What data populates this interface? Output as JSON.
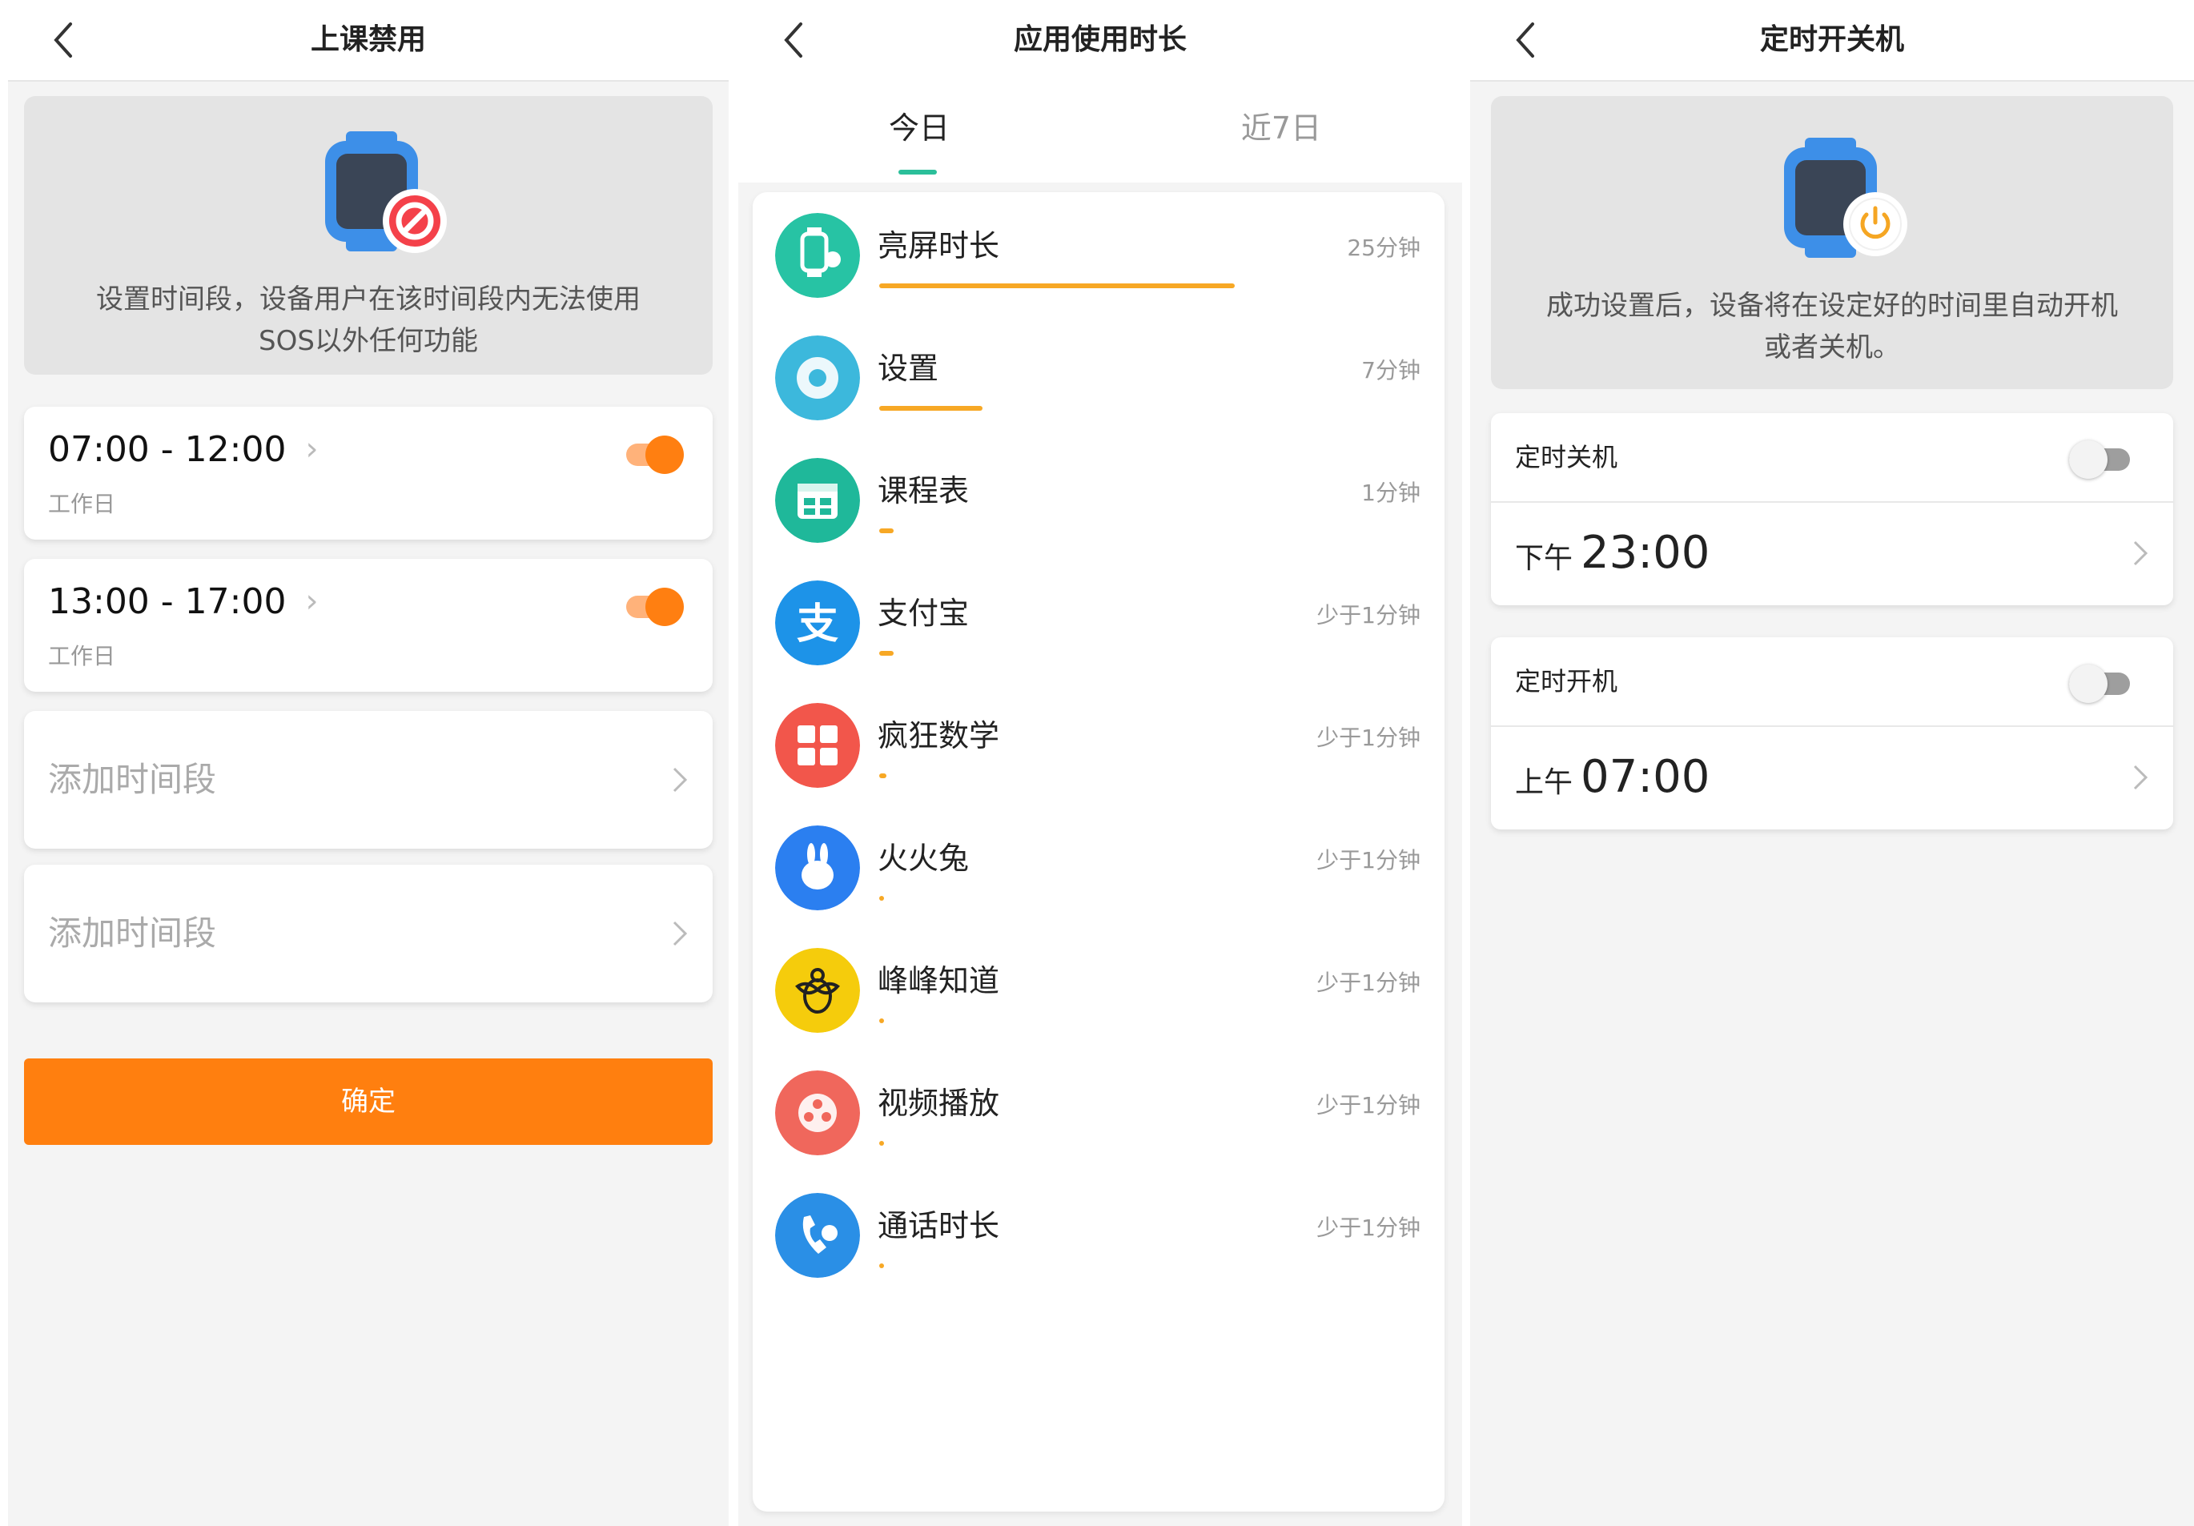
{
  "panel1": {
    "title": "上课禁用",
    "hero_text": "设置时间段，设备用户在该时间段内无法使用SOS以外任何功能",
    "periods": [
      {
        "time": "07:00 - 12:00",
        "days": "工作日",
        "enabled": true
      },
      {
        "time": "13:00 - 17:00",
        "days": "工作日",
        "enabled": true
      }
    ],
    "add_period_labels": [
      "添加时间段",
      "添加时间段"
    ],
    "confirm_label": "确定"
  },
  "panel2": {
    "title": "应用使用时长",
    "tabs": [
      {
        "label": "今日",
        "active": true
      },
      {
        "label": "近7日",
        "active": false
      }
    ],
    "apps": [
      {
        "name": "亮屏时长",
        "duration": "25分钟",
        "usage_fraction": 0.48,
        "icon": "watch-screen-icon",
        "color": "#27c3a4"
      },
      {
        "name": "设置",
        "duration": "7分钟",
        "usage_fraction": 0.14,
        "icon": "gear-icon",
        "color": "#3cb8dc"
      },
      {
        "name": "课程表",
        "duration": "1分钟",
        "usage_fraction": 0.02,
        "icon": "calendar-icon",
        "color": "#1fb89a"
      },
      {
        "name": "支付宝",
        "duration": "少于1分钟",
        "usage_fraction": 0.02,
        "icon": "alipay-icon",
        "color": "#1d93e8"
      },
      {
        "name": "疯狂数学",
        "duration": "少于1分钟",
        "usage_fraction": 0.01,
        "icon": "calculator-icon",
        "color": "#f2564b"
      },
      {
        "name": "火火兔",
        "duration": "少于1分钟",
        "usage_fraction": 0.005,
        "icon": "rabbit-icon",
        "color": "#2b7ff0"
      },
      {
        "name": "峰峰知道",
        "duration": "少于1分钟",
        "usage_fraction": 0.005,
        "icon": "bee-icon",
        "color": "#f5cc0c"
      },
      {
        "name": "视频播放",
        "duration": "少于1分钟",
        "usage_fraction": 0.005,
        "icon": "film-reel-icon",
        "color": "#f0675c"
      },
      {
        "name": "通话时长",
        "duration": "少于1分钟",
        "usage_fraction": 0.005,
        "icon": "phone-icon",
        "color": "#2a8fe6"
      }
    ]
  },
  "panel3": {
    "title": "定时开关机",
    "hero_text": "成功设置后，设备将在设定好的时间里自动开机或者关机。",
    "schedules": [
      {
        "label": "定时关机",
        "period": "下午",
        "time": "23:00",
        "enabled": false
      },
      {
        "label": "定时开机",
        "period": "上午",
        "time": "07:00",
        "enabled": false
      }
    ]
  },
  "colors": {
    "accent": "#ff7f0f",
    "tab_indicator": "#2bbf9a",
    "usage_bar": "#f7a825",
    "watch_blue": "#3d8fe8"
  }
}
